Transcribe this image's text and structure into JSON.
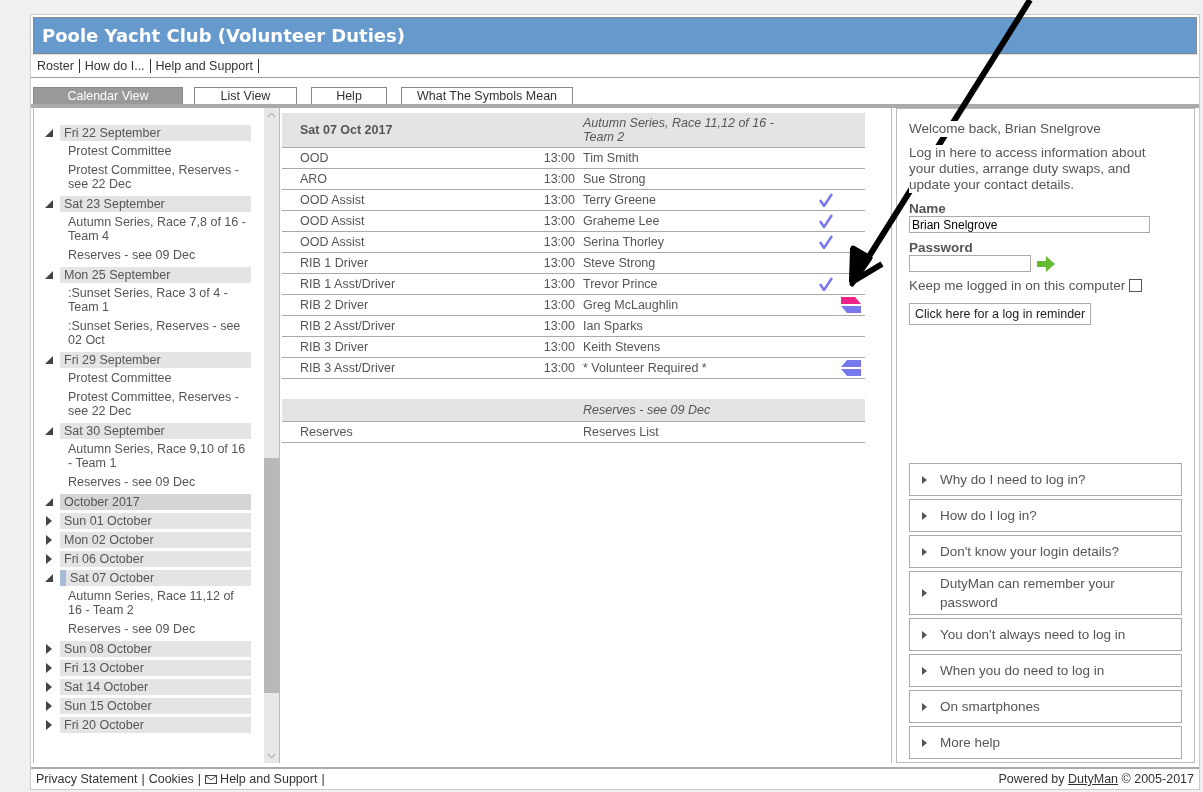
{
  "window": {
    "title": "Poole Yacht Club (Volunteer Duties)"
  },
  "menu": [
    {
      "label": "Roster"
    },
    {
      "label": "How do I..."
    },
    {
      "label": "Help and Support"
    }
  ],
  "tabs": [
    {
      "label": "Calendar View",
      "selected": true
    },
    {
      "label": "List View",
      "selected": false
    },
    {
      "label": "Help",
      "selected": false
    },
    {
      "label": "What The Symbols Mean",
      "selected": false
    }
  ],
  "tree": [
    {
      "label": "Fri 22 September",
      "kind": "day",
      "expanded": true,
      "selected": false,
      "children": [
        {
          "label": "Protest Committee"
        },
        {
          "label": "Protest Committee, Reserves - see 22 Dec"
        }
      ]
    },
    {
      "label": "Sat 23 September",
      "kind": "day",
      "expanded": true,
      "selected": false,
      "children": [
        {
          "label": "Autumn Series, Race 7,8 of 16 - Team 4"
        },
        {
          "label": "Reserves - see 09 Dec"
        }
      ]
    },
    {
      "label": "Mon 25 September",
      "kind": "day",
      "expanded": true,
      "selected": false,
      "children": [
        {
          "label": ":Sunset Series, Race 3 of 4 - Team 1"
        },
        {
          "label": ":Sunset Series, Reserves - see 02 Oct"
        }
      ]
    },
    {
      "label": "Fri 29 September",
      "kind": "day",
      "expanded": true,
      "selected": false,
      "children": [
        {
          "label": "Protest Committee"
        },
        {
          "label": "Protest Committee, Reserves - see 22 Dec"
        }
      ]
    },
    {
      "label": "Sat 30 September",
      "kind": "day",
      "expanded": true,
      "selected": false,
      "children": [
        {
          "label": "Autumn Series, Race 9,10 of 16 - Team 1"
        },
        {
          "label": "Reserves - see 09 Dec"
        }
      ]
    },
    {
      "label": "October 2017",
      "kind": "month",
      "expanded": true,
      "selected": false,
      "children": [
        {
          "label": "Sun 01 October",
          "kind": "day",
          "expanded": false,
          "selected": false
        },
        {
          "label": "Mon 02 October",
          "kind": "day",
          "expanded": false,
          "selected": false
        },
        {
          "label": "Fri 06 October",
          "kind": "day",
          "expanded": false,
          "selected": false
        },
        {
          "label": "Sat 07 October",
          "kind": "day",
          "expanded": true,
          "selected": true,
          "children": [
            {
              "label": "Autumn Series, Race 11,12 of 16 - Team 2"
            },
            {
              "label": "Reserves - see 09 Dec"
            }
          ]
        },
        {
          "label": "Sun 08 October",
          "kind": "day",
          "expanded": false,
          "selected": false
        },
        {
          "label": "Fri 13 October",
          "kind": "day",
          "expanded": false,
          "selected": false
        },
        {
          "label": "Sat 14 October",
          "kind": "day",
          "expanded": false,
          "selected": false
        },
        {
          "label": "Sun 15 October",
          "kind": "day",
          "expanded": false,
          "selected": false
        },
        {
          "label": "Fri 20 October",
          "kind": "day",
          "expanded": false,
          "selected": false
        }
      ]
    }
  ],
  "events": [
    {
      "date": "Sat 07 Oct 2017",
      "title": "Autumn Series, Race 11,12 of 16 - Team 2",
      "duties": [
        {
          "duty": "OOD",
          "time": "13:00",
          "name": "Tim Smith",
          "kind": "plain"
        },
        {
          "duty": "ARO",
          "time": "13:00",
          "name": "Sue Strong",
          "kind": "plain"
        },
        {
          "duty": "OOD Assist",
          "time": "13:00",
          "name": "Terry Greene",
          "kind": "confirmed"
        },
        {
          "duty": "OOD Assist",
          "time": "13:00",
          "name": "Graheme Lee",
          "kind": "confirmed"
        },
        {
          "duty": "OOD Assist",
          "time": "13:00",
          "name": "Serina Thorley",
          "kind": "confirmed"
        },
        {
          "duty": "RIB 1 Driver",
          "time": "13:00",
          "name": "Steve Strong",
          "kind": "plain"
        },
        {
          "duty": "RIB 1 Asst/Driver",
          "time": "13:00",
          "name": "Trevor Prince",
          "kind": "confirmed"
        },
        {
          "duty": "RIB 2 Driver",
          "time": "13:00",
          "name": "Greg McLaughlin",
          "kind": "swap"
        },
        {
          "duty": "RIB 2 Asst/Driver",
          "time": "13:00",
          "name": "Ian Sparks",
          "kind": "plain"
        },
        {
          "duty": "RIB 3 Driver",
          "time": "13:00",
          "name": "Keith Stevens",
          "kind": "plain"
        },
        {
          "duty": "RIB 3 Asst/Driver",
          "time": "13:00",
          "name": "* Volunteer Required *",
          "kind": "vacant"
        }
      ]
    },
    {
      "title": "Reserves - see 09 Dec",
      "duties": [
        {
          "duty": "Reserves",
          "name": "Reserves List",
          "kind": "plain"
        }
      ]
    }
  ],
  "login": {
    "welcome": "Welcome back, Brian Snelgrove",
    "intro": "Log in here to access information about your duties, arrange duty swaps, and update your contact details.",
    "name_label": "Name",
    "name_value": "Brian Snelgrove",
    "password_label": "Password",
    "keep_label": "Keep me logged in on this computer",
    "keep_checked": false,
    "reminder_button": "Click here for a log in reminder"
  },
  "help_items": [
    {
      "label": "Why do I need to log in?",
      "expanded": false
    },
    {
      "label": "How do I log in?",
      "expanded": false
    },
    {
      "label": "Don't know your login details?",
      "expanded": false
    },
    {
      "label": "DutyMan can remember your password",
      "expanded": false
    },
    {
      "label": "You don't always need to log in",
      "expanded": false
    },
    {
      "label": "When you do need to log in",
      "expanded": false
    },
    {
      "label": "On smartphones",
      "expanded": false
    },
    {
      "label": "More help",
      "expanded": false
    }
  ],
  "footer": {
    "links": [
      {
        "label": "Privacy Statement",
        "kind": "text"
      },
      {
        "label": "Cookies",
        "kind": "text"
      },
      {
        "label": "Help and Support",
        "kind": "mail"
      }
    ],
    "separator": "|",
    "powered_prefix": "Powered by",
    "powered_link": "DutyMan",
    "powered_suffix": "© 2005-2017"
  }
}
